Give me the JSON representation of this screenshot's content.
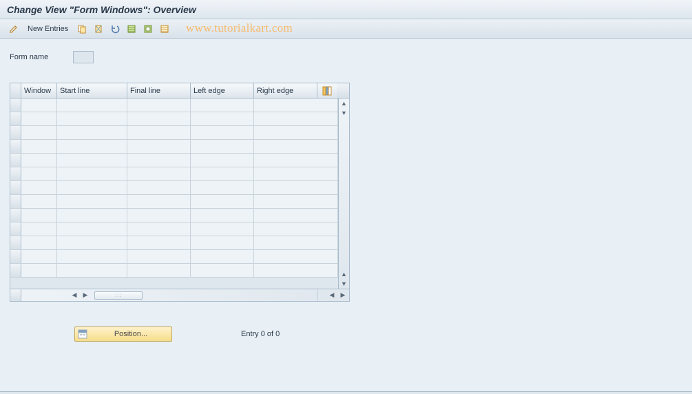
{
  "header": {
    "title": "Change View \"Form Windows\": Overview"
  },
  "toolbar": {
    "new_entries_label": "New Entries",
    "watermark": "www.tutorialkart.com"
  },
  "form": {
    "form_name_label": "Form name",
    "form_name_value": ""
  },
  "table": {
    "columns": {
      "window": "Window",
      "start_line": "Start line",
      "final_line": "Final line",
      "left_edge": "Left edge",
      "right_edge": "Right edge"
    },
    "rows": [
      {},
      {},
      {},
      {},
      {},
      {},
      {},
      {},
      {},
      {},
      {},
      {},
      {}
    ]
  },
  "footer": {
    "position_label": "Position...",
    "entry_status": "Entry 0 of 0"
  },
  "hscroll_thumb_text": ":::"
}
